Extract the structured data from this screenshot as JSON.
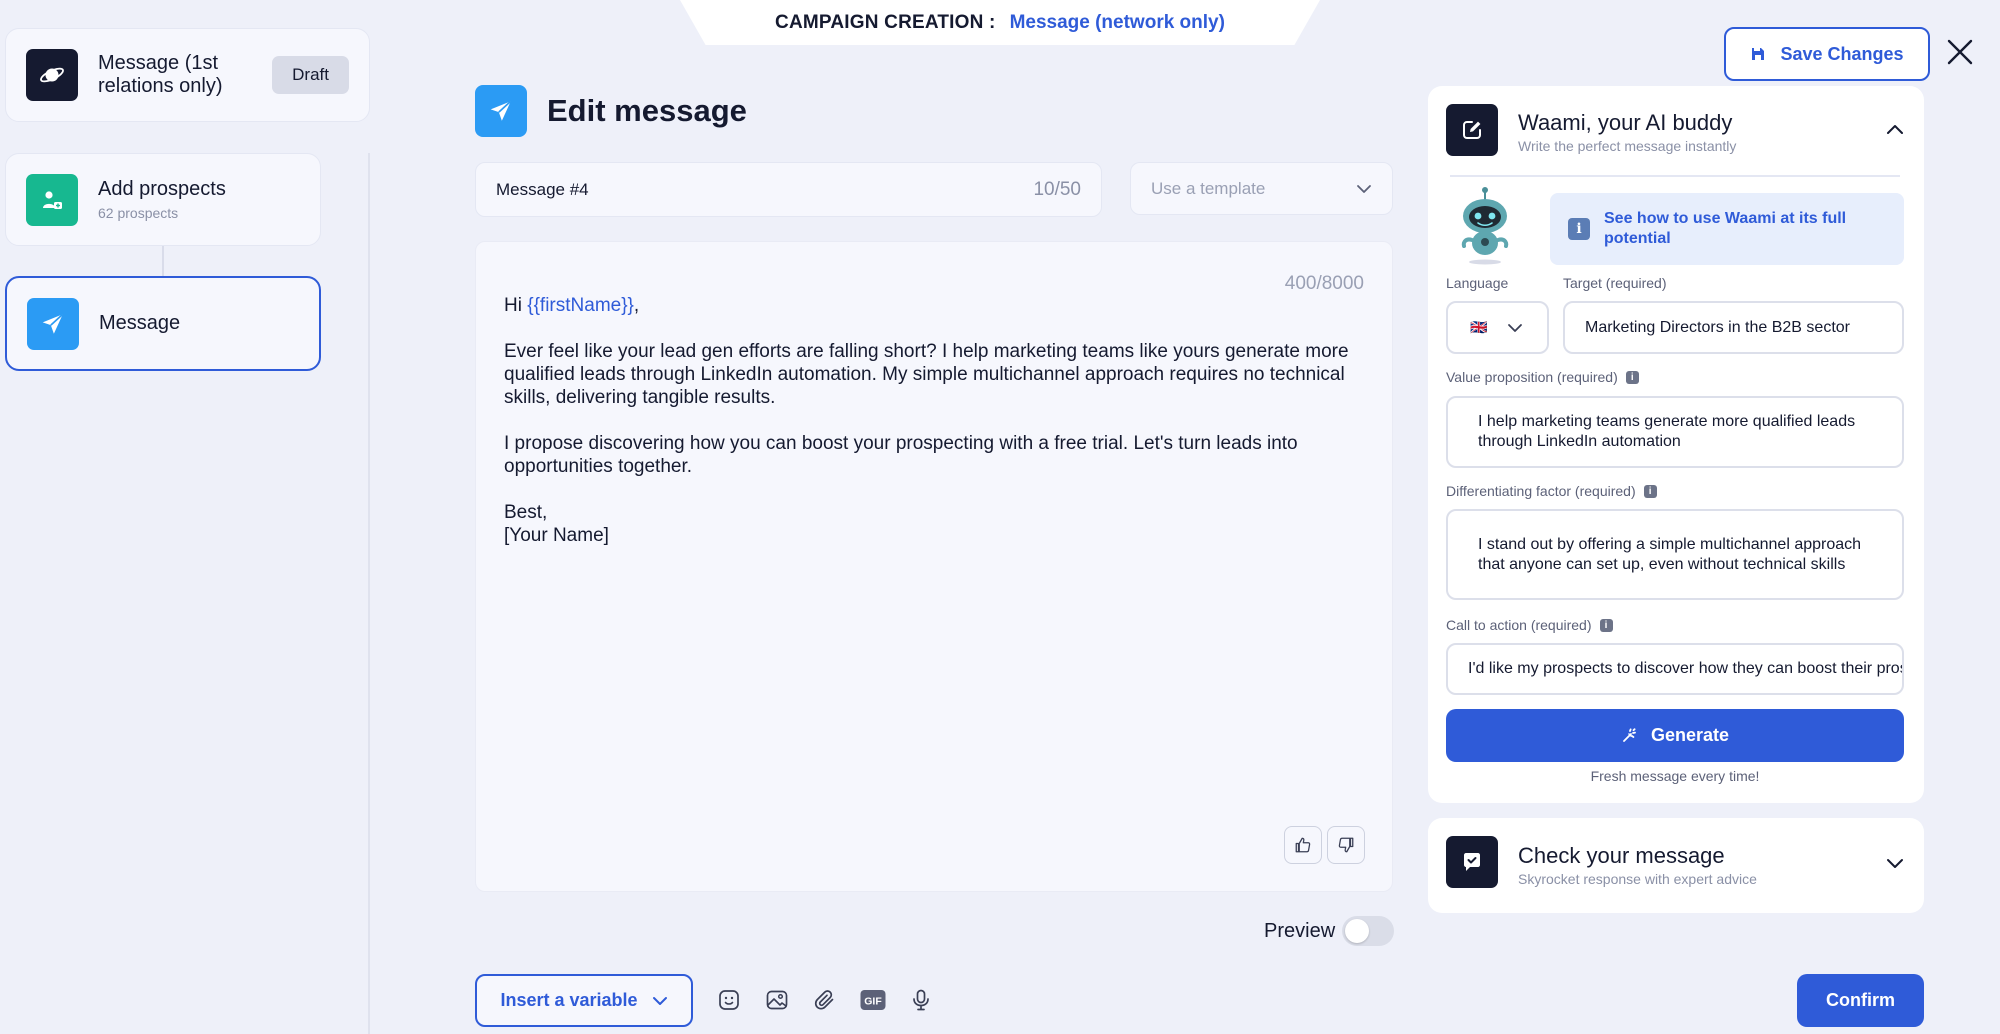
{
  "banner": {
    "label": "CAMPAIGN CREATION :",
    "value": "Message (network only)"
  },
  "steps": [
    {
      "title": "Message (1st relations only)",
      "badge": "Draft"
    },
    {
      "title": "Add prospects",
      "subtitle": "62 prospects"
    },
    {
      "title": "Message"
    }
  ],
  "editor": {
    "title": "Edit message",
    "name_value": "Message #4",
    "name_counter": "10/50",
    "template_placeholder": "Use a template",
    "char_count": "400/8000",
    "greeting_prefix": "Hi ",
    "greeting_variable": "{{firstName}}",
    "greeting_suffix": ",",
    "paragraph1": "Ever feel like your lead gen efforts are falling short? I help marketing teams like yours generate more qualified leads through LinkedIn automation. My simple multichannel approach requires no technical skills, delivering tangible results.",
    "paragraph2": "I propose discovering how you can boost your prospecting with a free trial. Let's turn leads into opportunities together.",
    "signoff": "Best,",
    "signature": "[Your Name]",
    "preview_label": "Preview",
    "preview_enabled": false,
    "insert_variable_label": "Insert a variable",
    "gif_label": "GIF"
  },
  "toolbar_icons": [
    "emoji-icon",
    "image-icon",
    "attachment-icon",
    "gif-icon",
    "microphone-icon"
  ],
  "header_actions": {
    "save_label": "Save Changes"
  },
  "ai_panel": {
    "title": "Waami, your AI buddy",
    "subtitle": "Write the perfect message instantly",
    "help_link": "See how to use Waami at its full potential",
    "language_label": "Language",
    "language_flag": "🇬🇧",
    "target_label": "Target (required)",
    "target_value": "Marketing Directors in the B2B sector",
    "value_prop_label": "Value proposition (required)",
    "value_prop_value": "I help marketing teams generate more qualified leads through LinkedIn automation",
    "diff_label": "Differentiating factor (required)",
    "diff_value": "I stand out by offering a simple multichannel approach that anyone can set up, even without technical skills",
    "cta_label": "Call to action (required)",
    "cta_value": "I'd like my prospects to discover how they can boost their prospecting with a free trial",
    "generate_label": "Generate",
    "fresh_note": "Fresh message every time!"
  },
  "check_panel": {
    "title": "Check your message",
    "subtitle": "Skyrocket response with expert advice"
  },
  "footer": {
    "confirm_label": "Confirm"
  },
  "colors": {
    "accent": "#2f5bd8",
    "background": "#eef0f9",
    "message_icon": "#2b9bf4",
    "prospects_icon": "#17b890",
    "dark_icon": "#151a30"
  }
}
